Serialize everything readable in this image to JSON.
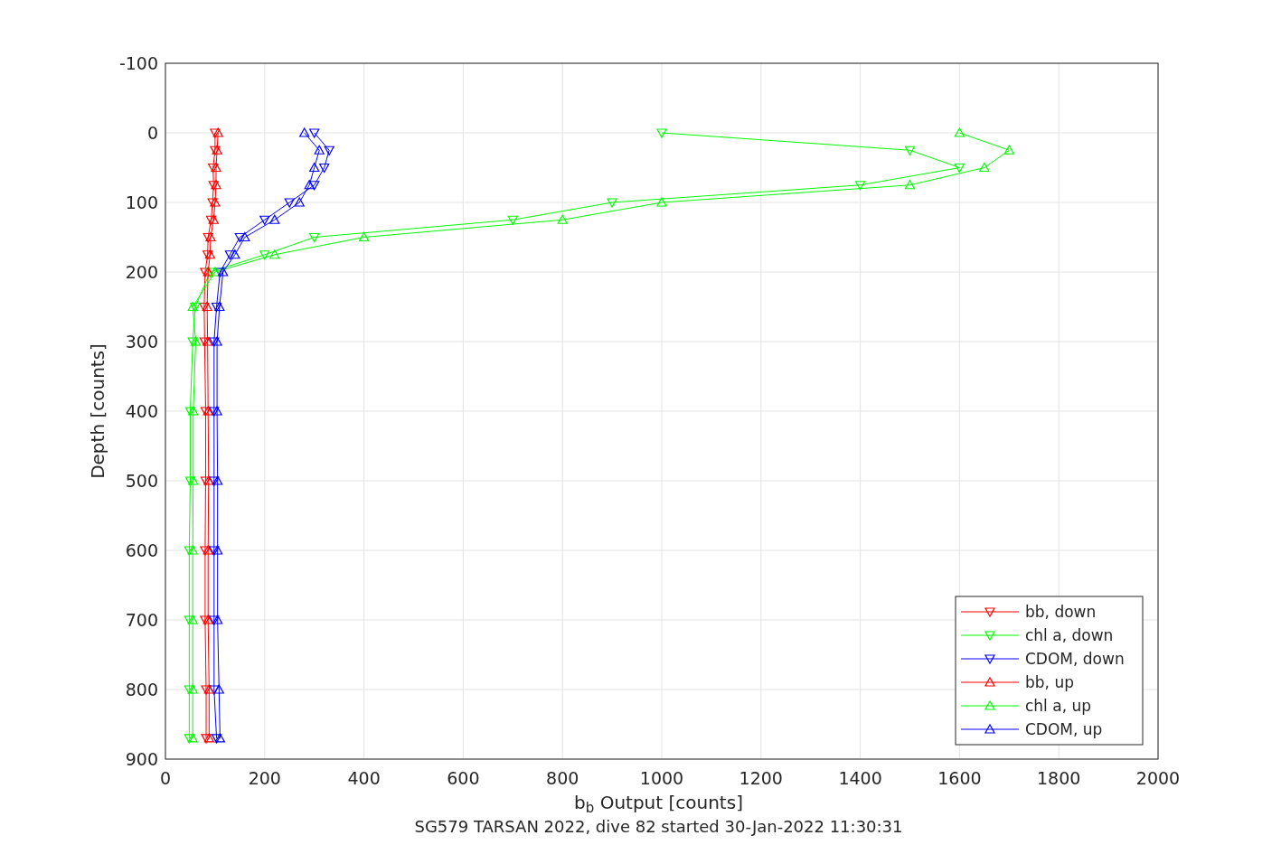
{
  "figure": {
    "chart_data": {
      "type": "line",
      "orientation": "horizontal",
      "xlabel": "b$_{b}$ Output [counts]",
      "ylabel": "Depth [counts]",
      "title": "SG579 TARSAN 2022, dive 82 started 30-Jan-2022 11:30:31",
      "x": [
        0,
        25,
        50,
        75,
        100,
        125,
        150,
        175,
        200,
        250,
        300,
        400,
        500,
        600,
        700,
        800,
        870
      ],
      "series": [
        {
          "name": "bb, down",
          "color": "#ff0000",
          "marker": "triangle",
          "values": [
            100,
            100,
            96,
            97,
            95,
            92,
            86,
            85,
            80,
            78,
            79,
            81,
            81,
            80,
            80,
            82,
            82
          ]
        },
        {
          "name": "chl a, down",
          "color": "#00ff00",
          "marker": "triangle",
          "values": [
            1000,
            1500,
            1600,
            1400,
            900,
            700,
            300,
            200,
            90,
            60,
            55,
            50,
            50,
            48,
            48,
            48,
            48
          ]
        },
        {
          "name": "CDOM, down",
          "color": "#0000ff",
          "marker": "triangle",
          "values": [
            300,
            330,
            320,
            300,
            250,
            200,
            150,
            130,
            110,
            103,
            98,
            98,
            98,
            98,
            98,
            98,
            103
          ]
        },
        {
          "name": "bb, up",
          "color": "#ff0000",
          "marker": "triangle",
          "values": [
            106,
            104,
            102,
            102,
            100,
            97,
            91,
            90,
            86,
            84,
            85,
            86,
            87,
            86,
            86,
            88,
            88
          ]
        },
        {
          "name": "chl a, up",
          "color": "#00ff00",
          "marker": "triangle",
          "values": [
            1600,
            1700,
            1650,
            1500,
            1000,
            800,
            400,
            220,
            100,
            55,
            61,
            56,
            56,
            55,
            55,
            55,
            55
          ]
        },
        {
          "name": "CDOM, up",
          "color": "#0000ff",
          "marker": "triangle",
          "values": [
            280,
            310,
            300,
            290,
            270,
            220,
            160,
            140,
            116,
            109,
            104,
            104,
            105,
            105,
            105,
            108,
            110
          ]
        }
      ],
      "xlim": [
        0,
        2000
      ],
      "ylim": [
        900,
        -100
      ],
      "grid": true,
      "legend": true,
      "xticks": [
        0,
        200,
        400,
        600,
        800,
        1000,
        1200,
        1400,
        1600,
        1800,
        2000
      ],
      "yticks": [
        -100,
        0,
        100,
        200,
        300,
        400,
        500,
        600,
        700,
        800,
        900
      ]
    }
  }
}
